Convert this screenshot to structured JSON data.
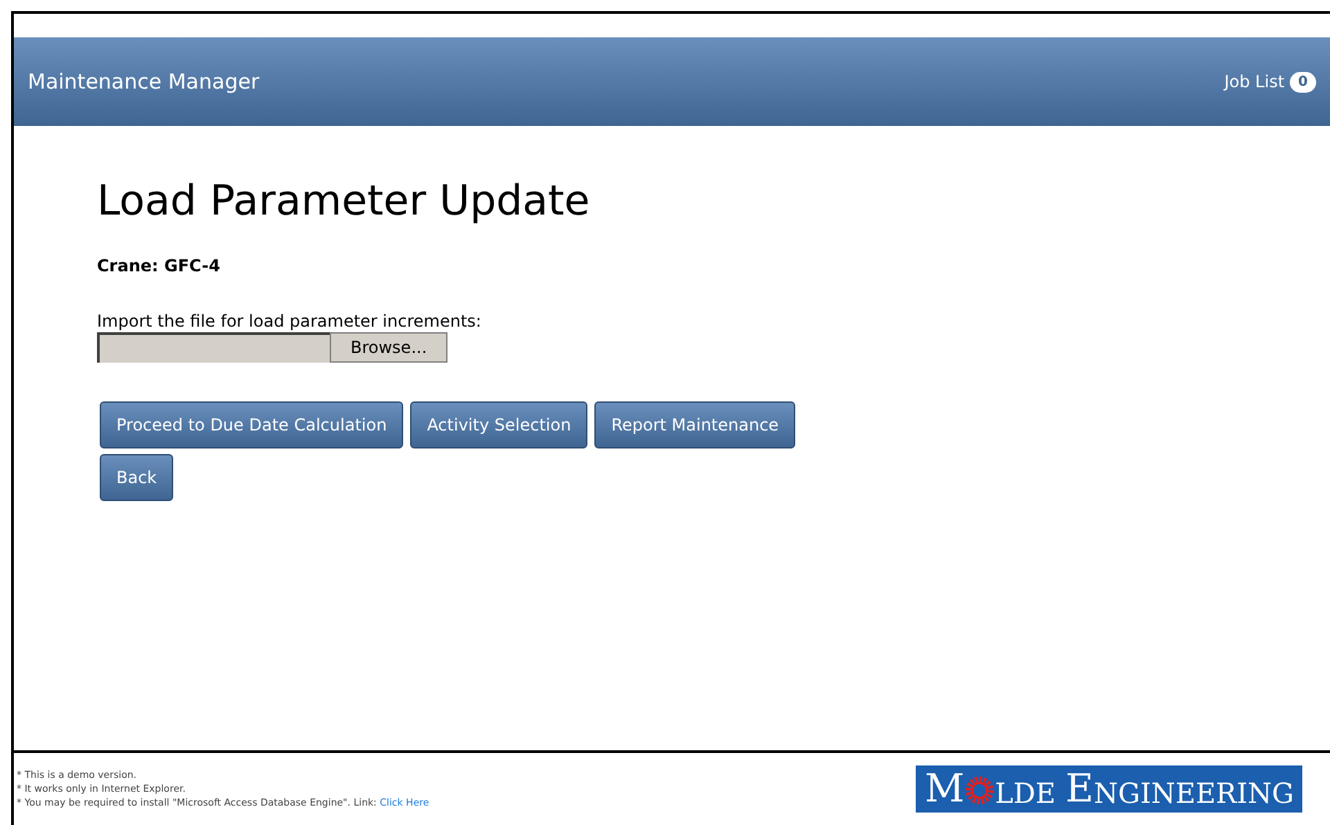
{
  "header": {
    "title": "Maintenance Manager",
    "job_list": {
      "label": "Job List",
      "count": "0"
    }
  },
  "page": {
    "title": "Load Parameter Update",
    "crane": "Crane: GFC-4",
    "import_label": "Import the file for load parameter increments:",
    "browse_button": "Browse..."
  },
  "button_rows": [
    [
      "Proceed to Due Date Calculation",
      "Activity Selection",
      "Report Maintenance"
    ],
    [
      "Back"
    ]
  ],
  "footer": {
    "notes": [
      "* This is a demo version.",
      "* It works only in Internet Explorer."
    ],
    "last_note": "* You may be required to install \"Microsoft Access Database Engine\". Link:",
    "link": "Click Here"
  },
  "logo": [
    {
      "text": "M",
      "kind": "big"
    },
    {
      "kind": "gear"
    },
    {
      "text": "LDE",
      "kind": "small"
    },
    {
      "text": "E",
      "kind": "big"
    },
    {
      "text": "NGINEERING",
      "kind": "small"
    }
  ]
}
